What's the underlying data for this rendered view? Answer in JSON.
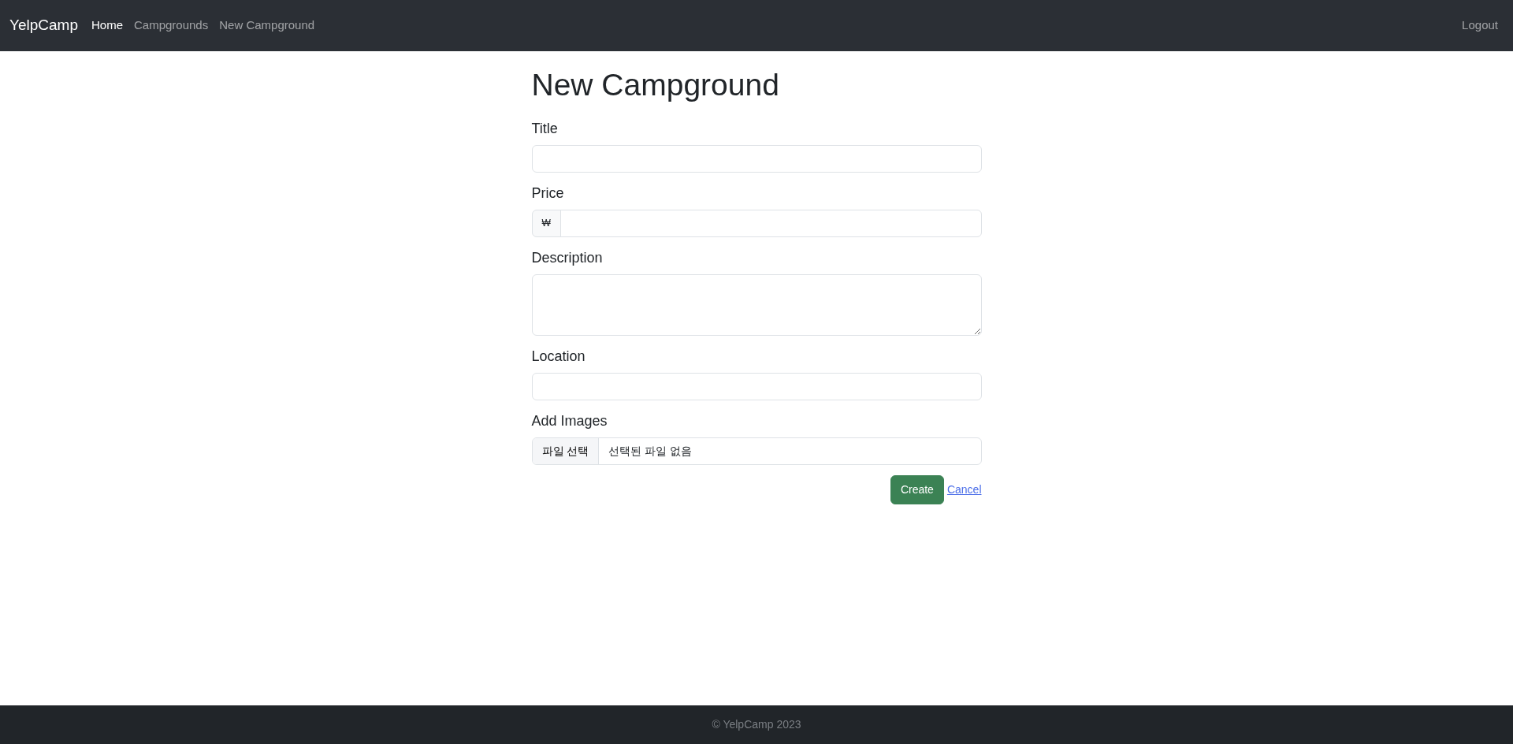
{
  "navbar": {
    "brand": "YelpCamp",
    "links": [
      {
        "label": "Home",
        "selected": true
      },
      {
        "label": "Campgrounds",
        "selected": false
      },
      {
        "label": "New Campground",
        "selected": false
      }
    ],
    "logout": "Logout"
  },
  "heading": "New Campground",
  "fields": [
    {
      "kind": "text",
      "label": "Title"
    },
    {
      "kind": "price",
      "label": "Price",
      "prefix": "₩"
    },
    {
      "kind": "textarea",
      "label": "Description"
    },
    {
      "kind": "text",
      "label": "Location"
    },
    {
      "kind": "file",
      "label": "Add Images",
      "button": "파일 선택",
      "status": "선택된 파일 없음"
    }
  ],
  "buttons": {
    "submit": "Create",
    "cancel": "Cancel"
  },
  "footer": "© YelpCamp 2023"
}
